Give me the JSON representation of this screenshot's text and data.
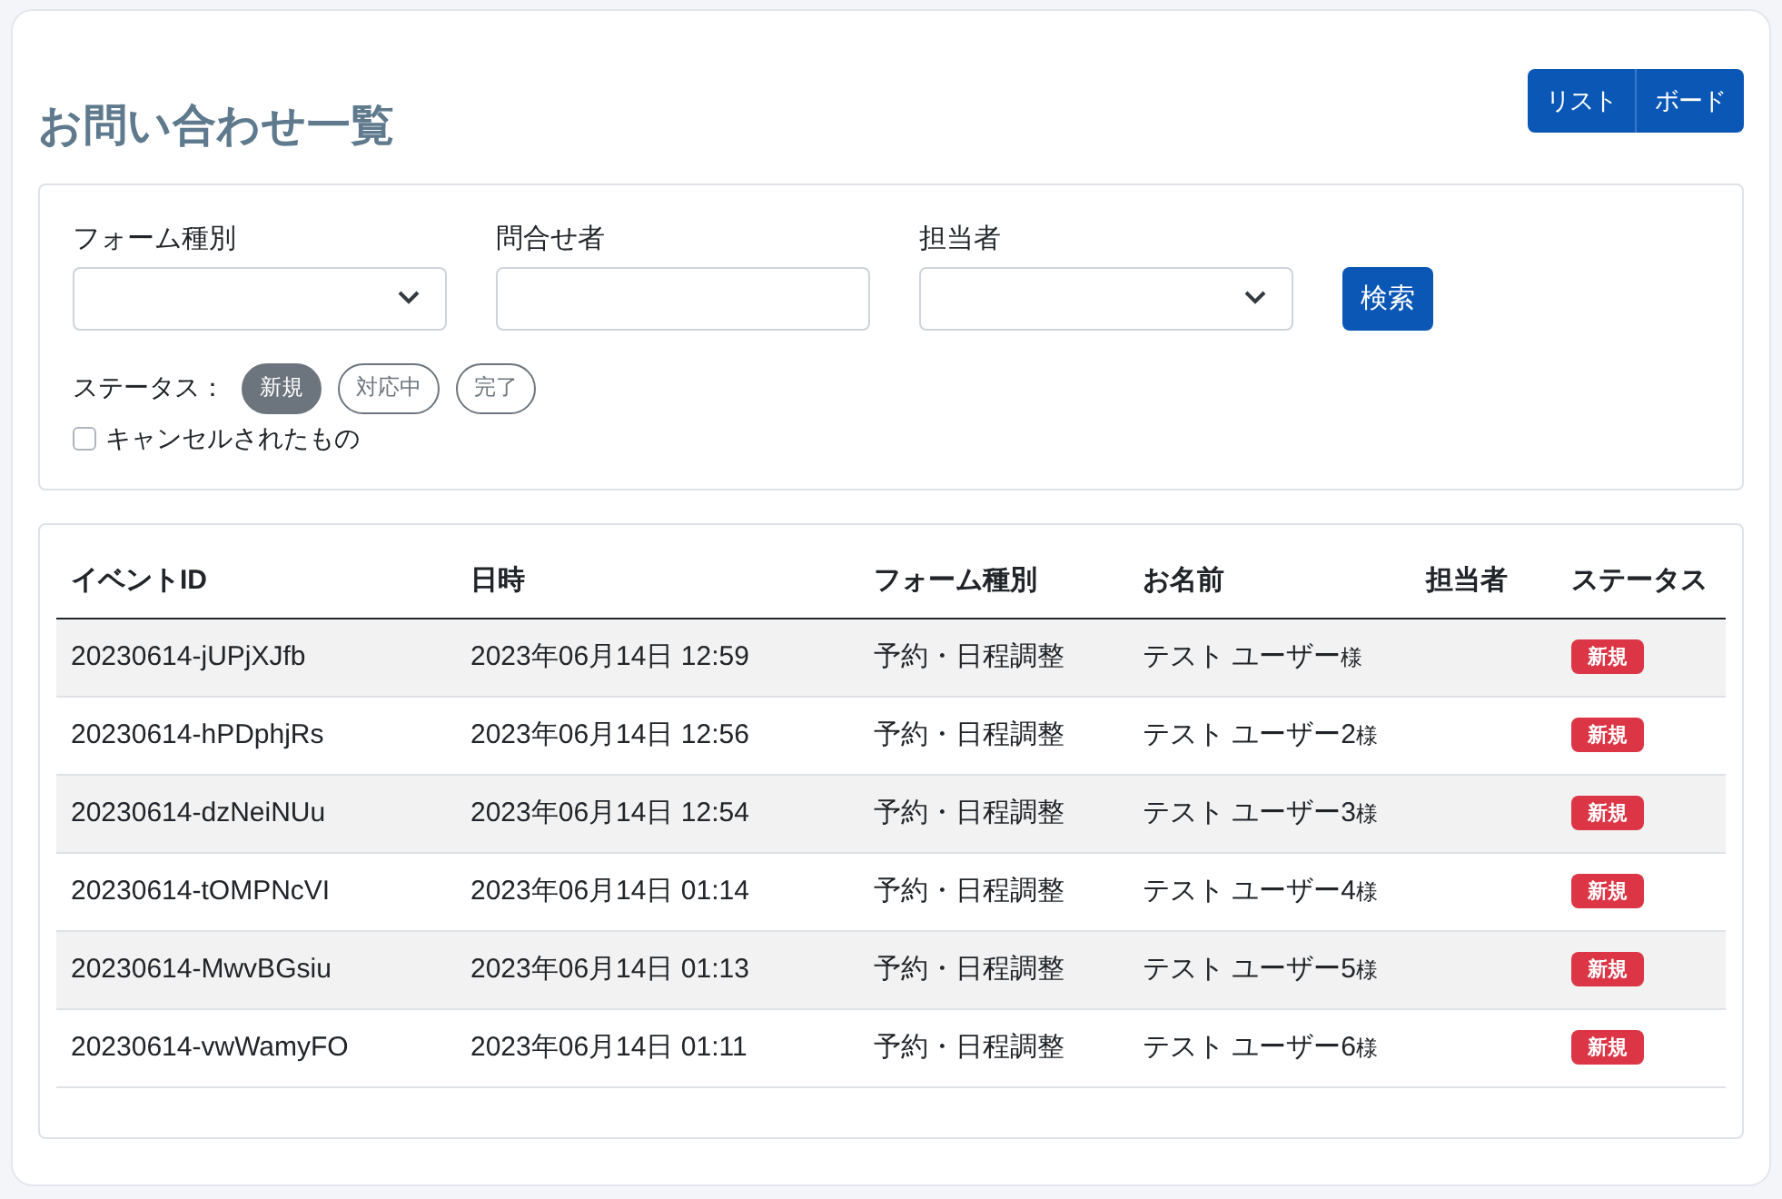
{
  "header": {
    "title": "お問い合わせ一覧",
    "view_buttons": [
      "リスト",
      "ボード"
    ]
  },
  "filters": {
    "fields": [
      {
        "kind": "select",
        "label": "フォーム種別"
      },
      {
        "kind": "text",
        "label": "問合せ者"
      },
      {
        "kind": "select",
        "label": "担当者"
      }
    ],
    "search_button": "検索",
    "status_label": "ステータス：",
    "statuses": [
      {
        "label": "新規",
        "selected": true
      },
      {
        "label": "対応中",
        "selected": false
      },
      {
        "label": "完了",
        "selected": false
      }
    ],
    "cancelled": {
      "label": "キャンセルされたもの",
      "checked": false
    }
  },
  "table": {
    "columns": [
      "イベントID",
      "日時",
      "フォーム種別",
      "お名前",
      "担当者",
      "ステータス"
    ],
    "rows": [
      {
        "id": "20230614-jUPjXJfb",
        "datetime": "2023年06月14日 12:59",
        "form": "予約・日程調整",
        "name": "テスト ユーザー",
        "honorific": "様",
        "status": "新規"
      },
      {
        "id": "20230614-hPDphjRs",
        "datetime": "2023年06月14日 12:56",
        "form": "予約・日程調整",
        "name": "テスト ユーザー2",
        "honorific": "様",
        "status": "新規"
      },
      {
        "id": "20230614-dzNeiNUu",
        "datetime": "2023年06月14日 12:54",
        "form": "予約・日程調整",
        "name": "テスト ユーザー3",
        "honorific": "様",
        "status": "新規"
      },
      {
        "id": "20230614-tOMPNcVI",
        "datetime": "2023年06月14日 01:14",
        "form": "予約・日程調整",
        "name": "テスト ユーザー4",
        "honorific": "様",
        "status": "新規"
      },
      {
        "id": "20230614-MwvBGsiu",
        "datetime": "2023年06月14日 01:13",
        "form": "予約・日程調整",
        "name": "テスト ユーザー5",
        "honorific": "様",
        "status": "新規"
      },
      {
        "id": "20230614-vwWamyFO",
        "datetime": "2023年06月14日 01:11",
        "form": "予約・日程調整",
        "name": "テスト ユーザー6",
        "honorific": "様",
        "status": "新規"
      }
    ]
  }
}
